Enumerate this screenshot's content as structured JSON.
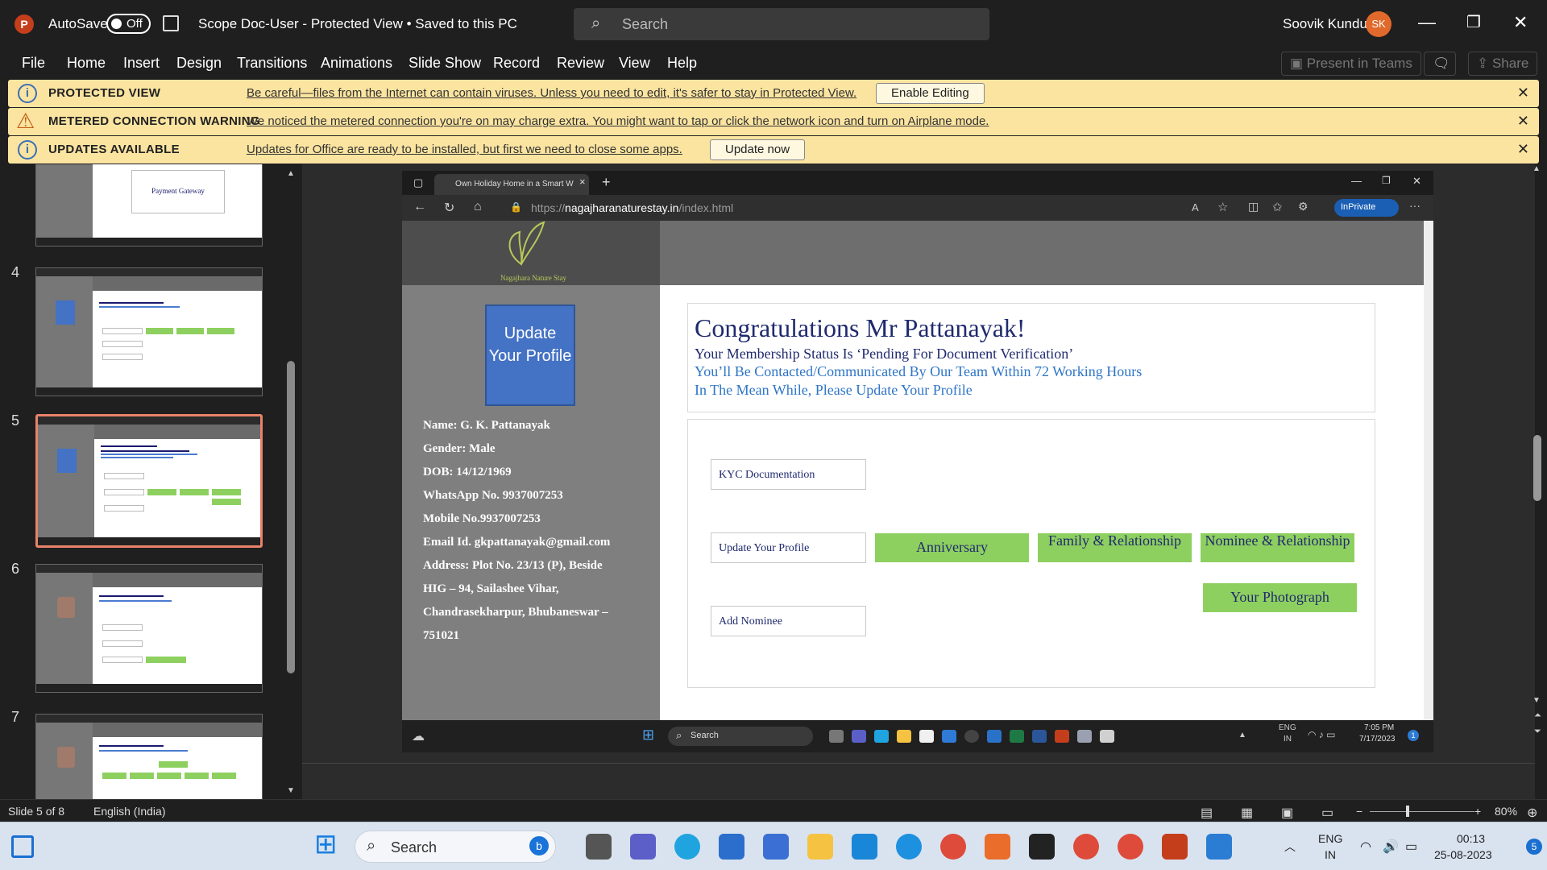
{
  "window": {
    "app_logo": "P",
    "autosave_label": "AutoSave",
    "autosave_state": "Off",
    "doc_title": "Scope Doc-User  -  Protected View  •  Saved to this PC",
    "search_placeholder": "Search",
    "user_name": "Soovik Kundu",
    "user_initials": "SK"
  },
  "menu": {
    "items": [
      "File",
      "Home",
      "Insert",
      "Design",
      "Transitions",
      "Animations",
      "Slide Show",
      "Record",
      "Review",
      "View",
      "Help"
    ],
    "present_in_teams": "Present in Teams",
    "share": "Share"
  },
  "notifications": [
    {
      "title": "PROTECTED VIEW",
      "message": "Be careful—files from the Internet can contain viruses. Unless you need to edit, it's safer to stay in Protected View.",
      "button": "Enable Editing"
    },
    {
      "title": "METERED CONNECTION WARNING",
      "message": "We noticed the metered connection you're on may charge extra. You might want to tap or click the network icon and turn on Airplane mode.",
      "button": ""
    },
    {
      "title": "UPDATES AVAILABLE",
      "message": "Updates for Office are ready to be installed, but first we need to close some apps.",
      "button": "Update now"
    }
  ],
  "thumbnails": {
    "numbers": [
      "4",
      "5",
      "6",
      "7"
    ],
    "partial_label": "Payment Gateway",
    "selected_number": "5"
  },
  "browser": {
    "tab_title": "Own Holiday Home in a Smart W",
    "url_prefix": "https://",
    "url_host": "nagajharanaturestay.in",
    "url_path": "/index.html",
    "inprivate": "InPrivate"
  },
  "site": {
    "logo_text": "Nagajhara Nature Stay",
    "update_profile_button": "Update Your Profile",
    "profile": {
      "name": "Name: G. K. Pattanayak",
      "gender": "Gender: Male",
      "dob": "DOB: 14/12/1969",
      "whatsapp": "WhatsApp No. 9937007253",
      "mobile": "Mobile No.9937007253",
      "email": "Email Id. gkpattanayak@gmail.com",
      "address1": "Address: Plot No. 23/13 (P), Beside",
      "address2": "HIG – 94, Sailashee Vihar,",
      "address3": "Chandrasekharpur, Bhubaneswar –",
      "address4": "751021"
    },
    "congrats_title": "Congratulations Mr Pattanayak!",
    "status_line": "Your Membership Status Is ‘Pending For Document Verification’",
    "contact_line": "You’ll Be Contacted/Communicated By Our Team Within 72 Working Hours",
    "update_line": "In The Mean While, Please Update Your Profile",
    "actions": {
      "kyc": "KYC Documentation",
      "update_profile": "Update Your Profile",
      "add_nominee": "Add Nominee",
      "anniversary": "Anniversary",
      "family": "Family & Relationship",
      "nominee_rel": "Nominee & Relationship",
      "photograph": "Your Photograph"
    }
  },
  "inner_taskbar": {
    "search": "Search",
    "lang1": "ENG",
    "lang2": "IN",
    "time": "7:05 PM",
    "date": "7/17/2023",
    "badge": "1"
  },
  "statusbar": {
    "slide_info": "Slide 5 of 8",
    "language": "English (India)",
    "zoom": "80%"
  },
  "taskbar": {
    "search": "Search",
    "lang1": "ENG",
    "lang2": "IN",
    "time": "00:13",
    "date": "25-08-2023",
    "badge": "5"
  }
}
